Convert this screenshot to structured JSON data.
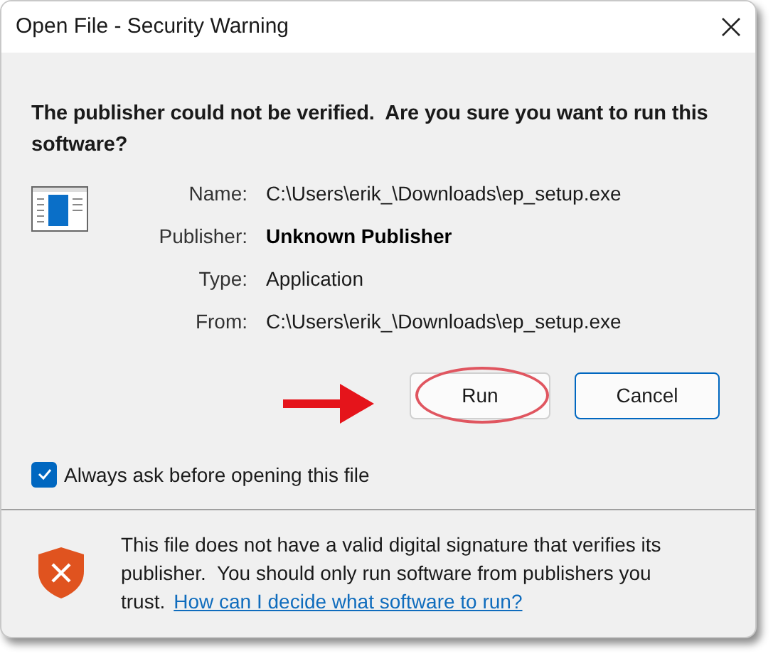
{
  "window": {
    "title": "Open File - Security Warning"
  },
  "heading": "The publisher could not be verified.  Are you sure you want to run this software?",
  "details": [
    {
      "label": "Name:",
      "value": "C:\\Users\\erik_\\Downloads\\ep_setup.exe",
      "bold": false
    },
    {
      "label": "Publisher:",
      "value": "Unknown Publisher",
      "bold": true
    },
    {
      "label": "Type:",
      "value": "Application",
      "bold": false
    },
    {
      "label": "From:",
      "value": "C:\\Users\\erik_\\Downloads\\ep_setup.exe",
      "bold": false
    }
  ],
  "buttons": [
    {
      "label": "Run",
      "focused": false,
      "circled": true
    },
    {
      "label": "Cancel",
      "focused": true,
      "circled": false
    }
  ],
  "checkbox": {
    "label": "Always ask before opening this file",
    "checked": true
  },
  "footer": {
    "text": "This file does not have a valid digital signature that verifies its publisher.  You should only run software from publishers you trust.",
    "link": "How can I decide what software to run?"
  }
}
